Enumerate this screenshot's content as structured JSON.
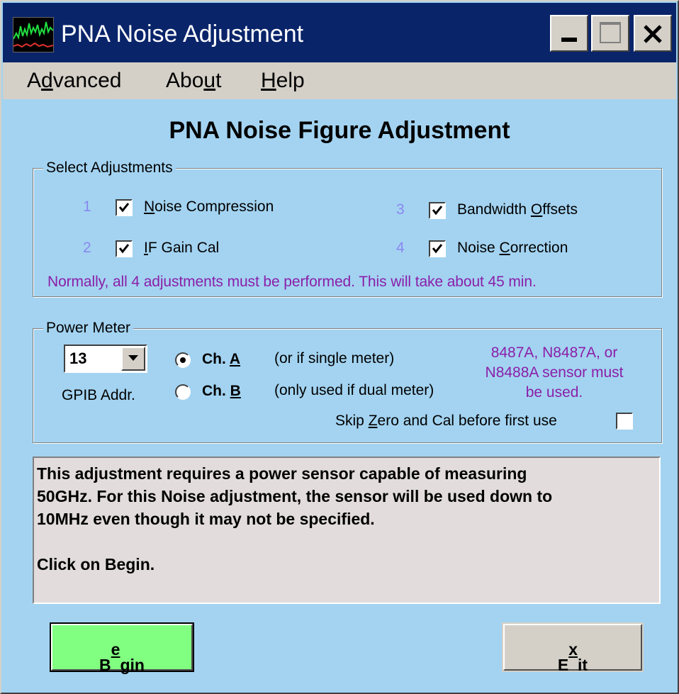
{
  "window": {
    "title": "PNA Noise Adjustment",
    "icon": "app-spectrum-icon",
    "controls": [
      "minimize-icon",
      "maximize-icon",
      "close-icon"
    ]
  },
  "menu": {
    "advanced": {
      "pre": "A",
      "key": "d",
      "post": "vanced"
    },
    "about": {
      "pre": "Abo",
      "key": "u",
      "post": "t"
    },
    "help": {
      "pre": "",
      "key": "H",
      "post": "elp"
    }
  },
  "heading": "PNA Noise Figure Adjustment",
  "adjustments": {
    "group_label": "Select Adjustments",
    "items": [
      {
        "number": "1",
        "pre": "",
        "key": "N",
        "post": "oise Compression",
        "checked": true
      },
      {
        "number": "2",
        "pre": "",
        "key": "I",
        "post": "F Gain Cal",
        "checked": true
      },
      {
        "number": "3",
        "pre": "Bandwidth ",
        "key": "O",
        "post": "ffsets",
        "checked": true
      },
      {
        "number": "4",
        "pre": "Noise ",
        "key": "C",
        "post": "orrection",
        "checked": true
      }
    ],
    "note": "Normally, all 4 adjustments must be performed.  This will take about 45 min."
  },
  "power_meter": {
    "group_label": "Power Meter",
    "gpib_value": "13",
    "gpib_label": "GPIB Addr.",
    "channels": [
      {
        "pre": "Ch. ",
        "key": "A",
        "desc": "(or if single meter)",
        "selected": true
      },
      {
        "pre": "Ch. ",
        "key": "B",
        "desc": "(only used if dual meter)",
        "selected": false
      }
    ],
    "sensor_note": [
      "8487A, N8487A, or",
      "N8488A sensor must",
      "be used."
    ],
    "skip": {
      "pre": "Skip ",
      "key": "Z",
      "post": "ero and Cal before first use",
      "checked": false
    }
  },
  "message": {
    "lines": [
      " This adjustment requires a power sensor capable of measuring",
      "50GHz.  For this Noise adjustment, the sensor will be used down to",
      "10MHz even though it may not be specified.",
      "",
      "Click on Begin."
    ]
  },
  "buttons": {
    "begin": {
      "pre": "B",
      "key": "e",
      "post": "gin"
    },
    "exit": {
      "pre": "E",
      "key": "x",
      "post": "it"
    }
  },
  "colors": {
    "background": "#a3d3f1",
    "titlebar": "#0a246a",
    "begin_button": "#80ff80",
    "accent_text": "#8b1fa8",
    "number_text": "#8a88f0"
  }
}
